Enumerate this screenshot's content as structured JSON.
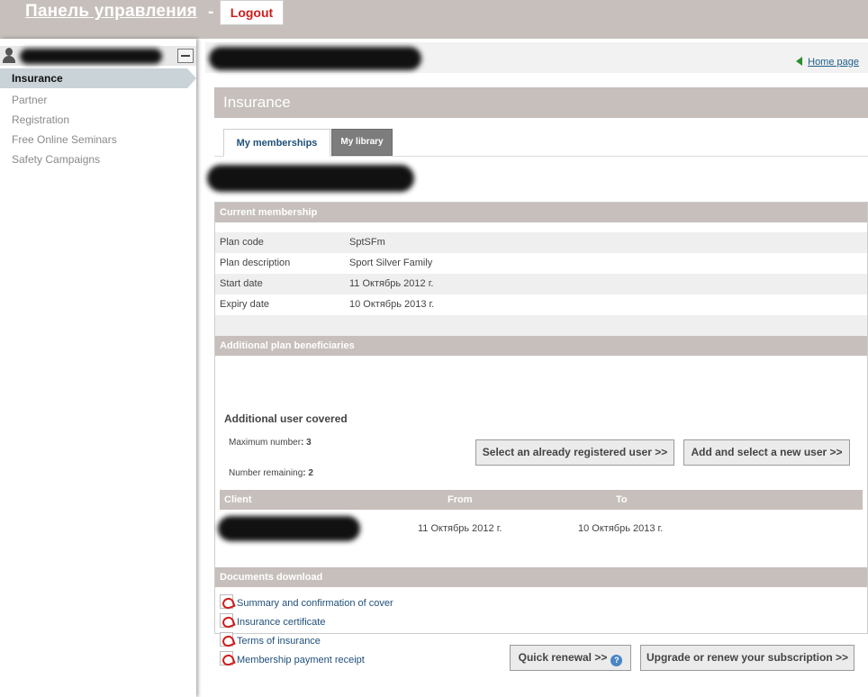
{
  "header": {
    "title": "Панель управления",
    "separator": "-",
    "logout_label": "Logout"
  },
  "sidebar": {
    "items": [
      {
        "label": "Insurance",
        "active": true
      },
      {
        "label": "Partner"
      },
      {
        "label": "Registration"
      },
      {
        "label": "Free Online Seminars"
      },
      {
        "label": "Safety Campaigns"
      }
    ]
  },
  "main": {
    "home_link": "Home page",
    "section_title": "Insurance",
    "tabs": [
      {
        "label": "My memberships",
        "active": true
      },
      {
        "label": "My library"
      }
    ],
    "membership": {
      "header": "Current membership",
      "rows": [
        {
          "label": "Plan code",
          "value": "SptSFm"
        },
        {
          "label": "Plan description",
          "value": "Sport Silver Family"
        },
        {
          "label": "Start date",
          "value": "11 Октябрь 2012 г."
        },
        {
          "label": "Expiry date",
          "value": "10 Октябрь 2013 г."
        }
      ]
    },
    "beneficiaries": {
      "header": "Additional plan beneficiaries",
      "subtitle": "Additional user covered",
      "max_label": "Maximum number",
      "max_value": "3",
      "remaining_label": "Number remaining",
      "remaining_value": "2",
      "select_button": "Select an already registered user >>",
      "add_button": "Add and select a new user >>",
      "columns": [
        "Client",
        "From",
        "To"
      ],
      "client_rows": [
        {
          "from": "11 Октябрь 2012 г.",
          "to": "10 Октябрь 2013 г."
        }
      ]
    },
    "documents": {
      "header": "Documents download",
      "items": [
        "Summary and confirmation of cover",
        "Insurance certificate",
        "Terms of insurance",
        "Membership payment receipt"
      ]
    },
    "quick_renewal": "Quick renewal >>",
    "upgrade_button": "Upgrade or renew your subscription >>"
  },
  "colors": {
    "header_bg": "#c6bfbb",
    "logout_text": "#cc1f1f",
    "link": "#1f4f7a",
    "active_nav": "#c9d3d8"
  }
}
